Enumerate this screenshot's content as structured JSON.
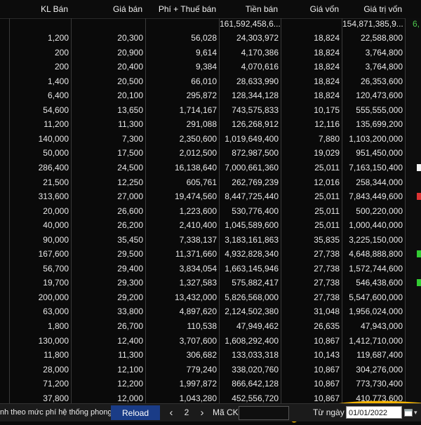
{
  "columns": [
    "KL Bán",
    "Giá bán",
    "Phí + Thuế bán",
    "Tiền bán",
    "Giá vốn",
    "Giá trị vốn"
  ],
  "total_row": [
    "",
    "",
    "",
    "161,592,458,6...",
    "",
    "154,871,385,9..."
  ],
  "edge_partial_total": "6,",
  "rows": [
    [
      "1,200",
      "20,300",
      "56,028",
      "24,303,972",
      "18,824",
      "22,588,800"
    ],
    [
      "200",
      "20,900",
      "9,614",
      "4,170,386",
      "18,824",
      "3,764,800"
    ],
    [
      "200",
      "20,400",
      "9,384",
      "4,070,616",
      "18,824",
      "3,764,800"
    ],
    [
      "1,400",
      "20,500",
      "66,010",
      "28,633,990",
      "18,824",
      "26,353,600"
    ],
    [
      "6,400",
      "20,100",
      "295,872",
      "128,344,128",
      "18,824",
      "120,473,600"
    ],
    [
      "54,600",
      "13,650",
      "1,714,167",
      "743,575,833",
      "10,175",
      "555,555,000"
    ],
    [
      "11,200",
      "11,300",
      "291,088",
      "126,268,912",
      "12,116",
      "135,699,200"
    ],
    [
      "140,000",
      "7,300",
      "2,350,600",
      "1,019,649,400",
      "7,880",
      "1,103,200,000"
    ],
    [
      "50,000",
      "17,500",
      "2,012,500",
      "872,987,500",
      "19,029",
      "951,450,000"
    ],
    [
      "286,400",
      "24,500",
      "16,138,640",
      "7,000,661,360",
      "25,011",
      "7,163,150,400"
    ],
    [
      "21,500",
      "12,250",
      "605,761",
      "262,769,239",
      "12,016",
      "258,344,000"
    ],
    [
      "313,600",
      "27,000",
      "19,474,560",
      "8,447,725,440",
      "25,011",
      "7,843,449,600"
    ],
    [
      "20,000",
      "26,600",
      "1,223,600",
      "530,776,400",
      "25,011",
      "500,220,000"
    ],
    [
      "40,000",
      "26,200",
      "2,410,400",
      "1,045,589,600",
      "25,011",
      "1,000,440,000"
    ],
    [
      "90,000",
      "35,450",
      "7,338,137",
      "3,183,161,863",
      "35,835",
      "3,225,150,000"
    ],
    [
      "167,600",
      "29,500",
      "11,371,660",
      "4,932,828,340",
      "27,738",
      "4,648,888,800"
    ],
    [
      "56,700",
      "29,400",
      "3,834,054",
      "1,663,145,946",
      "27,738",
      "1,572,744,600"
    ],
    [
      "19,700",
      "29,300",
      "1,327,583",
      "575,882,417",
      "27,738",
      "546,438,600"
    ],
    [
      "200,000",
      "29,200",
      "13,432,000",
      "5,826,568,000",
      "27,738",
      "5,547,600,000"
    ],
    [
      "63,000",
      "33,800",
      "4,897,620",
      "2,124,502,380",
      "31,048",
      "1,956,024,000"
    ],
    [
      "1,800",
      "26,700",
      "110,538",
      "47,949,462",
      "26,635",
      "47,943,000"
    ],
    [
      "130,000",
      "12,400",
      "3,707,600",
      "1,608,292,400",
      "10,867",
      "1,412,710,000"
    ],
    [
      "11,800",
      "11,300",
      "306,682",
      "133,033,318",
      "10,143",
      "119,687,400"
    ],
    [
      "28,000",
      "12,100",
      "779,240",
      "338,020,760",
      "10,867",
      "304,276,000"
    ],
    [
      "71,200",
      "12,200",
      "1,997,872",
      "866,642,128",
      "10,867",
      "773,730,400"
    ],
    [
      "37,800",
      "12,000",
      "1,043,280",
      "452,556,720",
      "10,867",
      "410,773,600"
    ]
  ],
  "bottom": {
    "status_text": "nh theo mức phí hệ thống phong tỏa",
    "reload_label": "Reload",
    "prev_icon": "‹",
    "page_number": "2",
    "next_icon": "›",
    "symbol_label": "Mã CK",
    "from_date_label": "Từ ngày",
    "from_date_value": "01/01/2022"
  },
  "colors": {
    "background": "#0a0a0a",
    "text": "#e8e8e8",
    "total_green": "#4ec94e",
    "reload_bg": "#1a3c87",
    "highlight_swoosh": "#f5b400"
  }
}
